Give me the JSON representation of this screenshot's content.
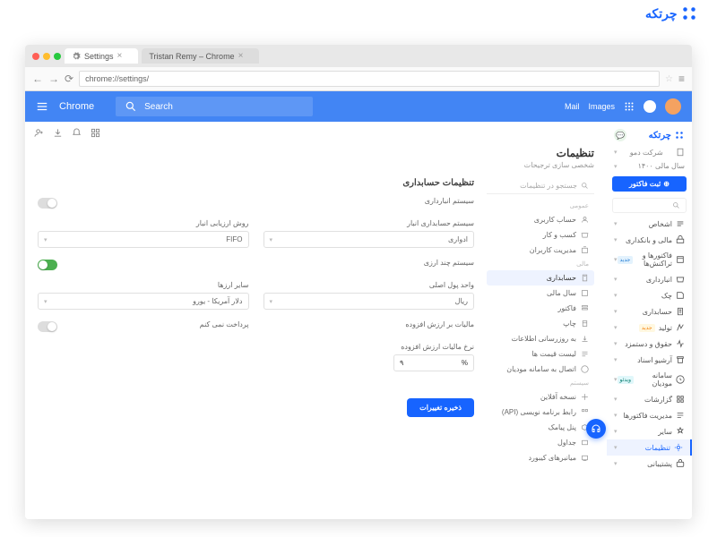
{
  "brand": {
    "name": "چرتکه"
  },
  "browser": {
    "tabs": [
      {
        "label": "Settings"
      },
      {
        "label": "Tristan Remy – Chrome"
      }
    ],
    "address": "chrome://settings/"
  },
  "chrome_header": {
    "title": "Chrome",
    "search_placeholder": "Search",
    "mail": "Mail",
    "images": "Images"
  },
  "sidebar": {
    "company_label": "شرکت دمو",
    "fiscal_year": "سال مالی ۱۴۰۰",
    "primary_btn": "ثبت فاکتور",
    "items": [
      {
        "label": "اشخاص"
      },
      {
        "label": "مالی و بانکداری"
      },
      {
        "label": "فاکتورها و تراکنش‌ها",
        "badge": "جدید"
      },
      {
        "label": "انبارداری"
      },
      {
        "label": "چک"
      },
      {
        "label": "حسابداری"
      },
      {
        "label": "تولید",
        "badge": "جدید",
        "badgeClass": "amber"
      },
      {
        "label": "حقوق و دستمزد"
      },
      {
        "label": "آرشیو اسناد"
      },
      {
        "label": "سامانه مودیان",
        "badge": "ویدئو",
        "badgeClass": "teal"
      },
      {
        "label": "گزارشات"
      },
      {
        "label": "مدیریت فاکتورها"
      },
      {
        "label": "سایر"
      },
      {
        "label": "تنظیمات",
        "active": true
      },
      {
        "label": "پشتیبانی"
      }
    ]
  },
  "page": {
    "title": "تنظیمات",
    "subtitle": "شخصی سازی ترجیحات"
  },
  "settings_nav": {
    "search_placeholder": "جستجو در تنظیمات",
    "groups": [
      {
        "label": "عمومی",
        "items": [
          {
            "label": "حساب کاربری"
          },
          {
            "label": "کسب و کار"
          },
          {
            "label": "مدیریت کاربران"
          }
        ]
      },
      {
        "label": "مالی",
        "items": [
          {
            "label": "حسابداری",
            "active": true
          },
          {
            "label": "سال مالی"
          },
          {
            "label": "فاکتور"
          },
          {
            "label": "چاپ"
          },
          {
            "label": "به روزرسانی اطلاعات"
          },
          {
            "label": "لیست قیمت ها"
          },
          {
            "label": "اتصال به سامانه مودیان"
          }
        ]
      },
      {
        "label": "سیستم",
        "items": [
          {
            "label": "نسخه آفلاین"
          },
          {
            "label": "رابط برنامه نویسی (API)"
          },
          {
            "label": "پنل پیامک"
          },
          {
            "label": "جداول"
          },
          {
            "label": "میانبر‌های کیبورد"
          }
        ]
      }
    ]
  },
  "form": {
    "panel_title": "تنظیمات حسابداری",
    "inventory_system_label": "سیستم انبارداری",
    "accounting_system_label": "سیستم حسابداری انبار",
    "accounting_system_value": "ادواری",
    "valuation_label": "روش ارزیابی انبار",
    "valuation_value": "FIFO",
    "multicurrency_label": "سیستم چند ارزی",
    "base_currency_label": "واحد پول اصلی",
    "base_currency_value": "ریال",
    "other_currencies_label": "سایر ارزها",
    "other_currencies_value": "دلار آمریکا - یورو",
    "vat_label": "مالیات بر ارزش افزوده",
    "no_pay_label": "پرداخت نمی کنم",
    "vat_rate_label": "نرخ مالیات ارزش افزوده",
    "vat_rate_value": "۹",
    "pct": "%",
    "save": "ذخیره تغییرات"
  }
}
